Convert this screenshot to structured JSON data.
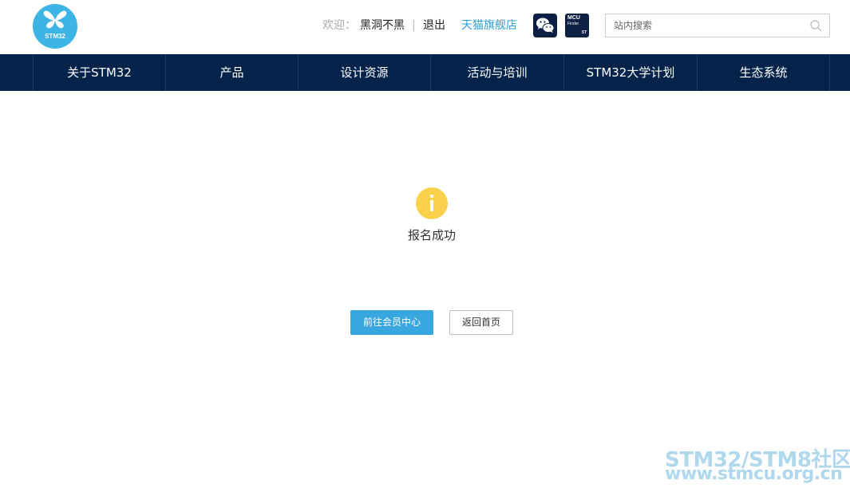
{
  "header": {
    "logo_text": "STM32",
    "welcome_label": "欢迎：",
    "username": "黑洞不黑",
    "separator": "|",
    "logout_label": "退出",
    "tmall_label": "天猫旗舰店",
    "wechat_icon": "wechat-icon",
    "mcu_finder": {
      "line1": "MCU",
      "line2": "Finder",
      "brand": "ST"
    },
    "search": {
      "placeholder": "站内搜索",
      "icon": "search-icon"
    }
  },
  "nav": {
    "items": [
      {
        "label": "关于STM32"
      },
      {
        "label": "产品"
      },
      {
        "label": "设计资源"
      },
      {
        "label": "活动与培训"
      },
      {
        "label": "STM32大学计划"
      },
      {
        "label": "生态系统"
      }
    ]
  },
  "main": {
    "status_icon": "info-icon",
    "message": "报名成功",
    "primary_button": "前往会员中心",
    "secondary_button": "返回首页"
  },
  "watermark": {
    "line1": "STM32/STM8社区",
    "line2": "www.stmcu.org.cn"
  },
  "colors": {
    "nav_bg": "#03234b",
    "accent": "#38a7e0",
    "logo": "#3cb4e5",
    "info_icon": "#fbd14b"
  }
}
